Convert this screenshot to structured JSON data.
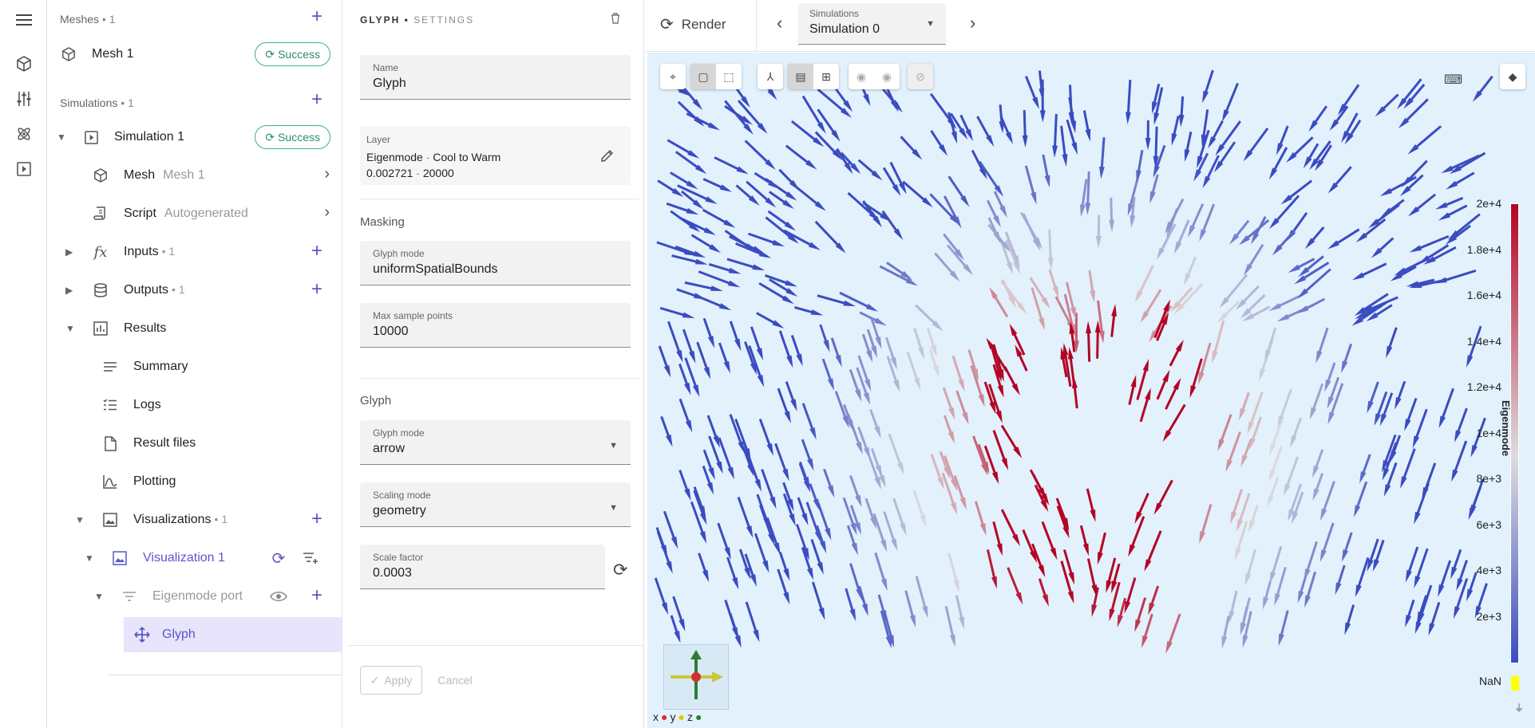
{
  "rail": {
    "icons": [
      "menu-icon",
      "mesh-cube-icon",
      "tune-sliders-icon",
      "atom-icon",
      "play-box-icon"
    ]
  },
  "meshes": {
    "title": "Meshes",
    "count": "1",
    "item": {
      "label": "Mesh 1",
      "status": "Success"
    }
  },
  "simulations": {
    "title": "Simulations",
    "count": "1",
    "item": {
      "label": "Simulation 1",
      "status": "Success"
    },
    "mesh": {
      "label": "Mesh",
      "value": "Mesh 1"
    },
    "script": {
      "label": "Script",
      "value": "Autogenerated"
    },
    "inputs": {
      "label": "Inputs",
      "count": "1"
    },
    "outputs": {
      "label": "Outputs",
      "count": "1"
    },
    "results": {
      "label": "Results",
      "children": [
        "Summary",
        "Logs",
        "Result files",
        "Plotting"
      ]
    },
    "visualizations": {
      "label": "Visualizations",
      "count": "1"
    },
    "visualization": {
      "label": "Visualization 1"
    },
    "filter": {
      "label": "Eigenmode port"
    },
    "glyph": {
      "label": "Glyph"
    }
  },
  "settings": {
    "head_main": "GLYPH",
    "head_sep": "•",
    "head_sub": "SETTINGS",
    "name": {
      "label": "Name",
      "value": "Glyph"
    },
    "layer": {
      "label": "Layer",
      "field": "Eigenmode",
      "colormap": "Cool to Warm",
      "min": "0.002721",
      "max": "20000",
      "sep": "-"
    },
    "masking_title": "Masking",
    "masking_mode": {
      "label": "Glyph mode",
      "value": "uniformSpatialBounds"
    },
    "max_points": {
      "label": "Max sample points",
      "value": "10000"
    },
    "glyph_title": "Glyph",
    "glyph_mode": {
      "label": "Glyph mode",
      "value": "arrow"
    },
    "scaling_mode": {
      "label": "Scaling mode",
      "value": "geometry"
    },
    "scale_factor": {
      "label": "Scale factor",
      "value": "0.0003"
    },
    "apply": "Apply",
    "cancel": "Cancel"
  },
  "viewport": {
    "render": "Render",
    "sim_select": {
      "label": "Simulations",
      "value": "Simulation 0"
    },
    "colorbar": {
      "title": "Eigenmode",
      "ticks": [
        "2e+4",
        "1.8e+4",
        "1.6e+4",
        "1.4e+4",
        "1.2e+4",
        "1e+4",
        "8e+3",
        "6e+3",
        "4e+3",
        "2e+3"
      ],
      "nan": "NaN",
      "colors": {
        "high": "#b40426",
        "mid": "#dddddd",
        "low": "#3b4cc0",
        "nan": "#ffff00"
      }
    },
    "axes": {
      "x": "x",
      "y": "y",
      "z": "z"
    },
    "accent": "#5b56c9",
    "background": "#e2f1fc"
  }
}
